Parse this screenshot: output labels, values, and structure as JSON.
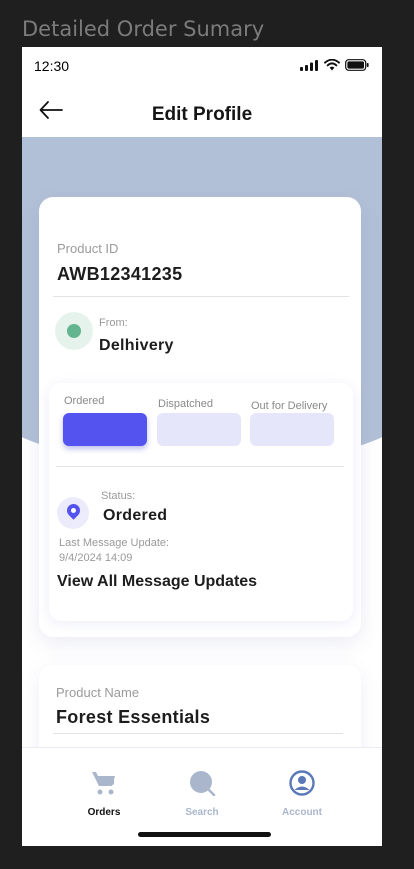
{
  "frame_title": "Detailed Order Sumary",
  "status_bar": {
    "time": "12:30"
  },
  "header": {
    "title": "Edit Profile"
  },
  "order": {
    "product_id_label": "Product ID",
    "product_id": "AWB12341235",
    "from_label": "From:",
    "from_value": "Delhivery",
    "steps": [
      {
        "label": "Ordered",
        "active": true
      },
      {
        "label": "Dispatched",
        "active": false
      },
      {
        "label": "Out for Delivery",
        "active": false
      }
    ],
    "status_label": "Status:",
    "status_value": "Ordered",
    "last_update_label": "Last Message Update:",
    "last_update_value": "9/4/2024 14:09",
    "view_all_link": "View All Message Updates"
  },
  "product": {
    "name_label": "Product Name",
    "name_value": "Forest Essentials"
  },
  "tabbar": {
    "tabs": [
      {
        "label": "Orders",
        "icon": "cart-icon",
        "active": true
      },
      {
        "label": "Search",
        "icon": "search-icon",
        "active": false
      },
      {
        "label": "Account",
        "icon": "account-icon",
        "active": false
      }
    ]
  },
  "colors": {
    "accent": "#5553f0",
    "hero": "#b2c0d7",
    "inactive_step": "#e6e6fa",
    "from_dot": "#62b58e"
  }
}
